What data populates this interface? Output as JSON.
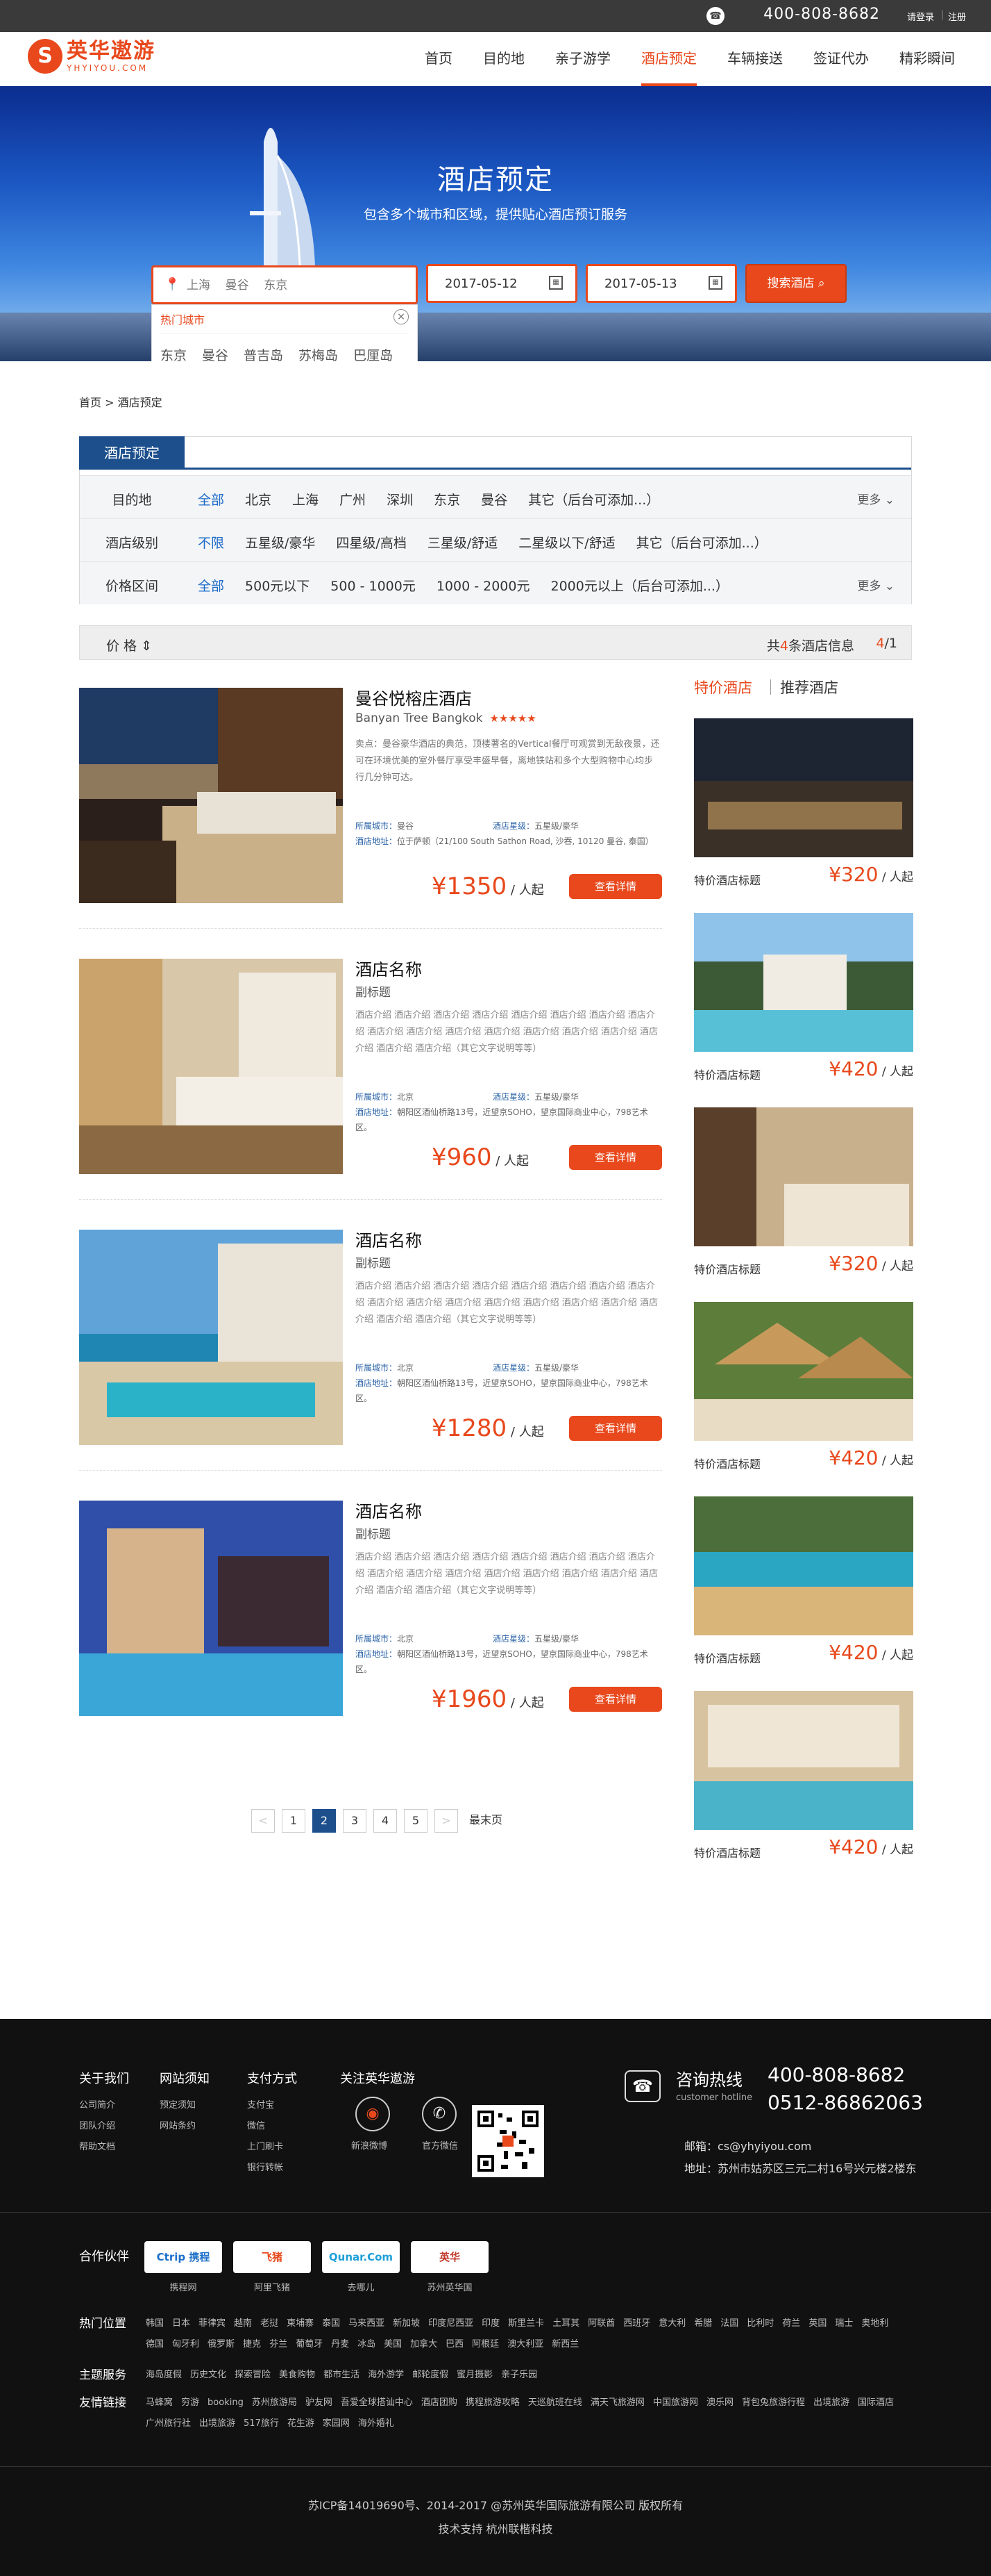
{
  "topbar": {
    "phone": "400-808-8682",
    "login": "请登录",
    "sep": "|",
    "register": "注册"
  },
  "logo": {
    "cn": "英华遨游",
    "en": "YHYIYOU.COM"
  },
  "nav": [
    "首页",
    "目的地",
    "亲子游学",
    "酒店预定",
    "车辆接送",
    "签证代办",
    "精彩瞬间"
  ],
  "banner": {
    "title": "酒店预定",
    "subtitle": "包含多个城市和区域，提供贴心酒店预订服务"
  },
  "search": {
    "placeholder": "上海    曼谷    东京",
    "checkin": "2017-05-12",
    "checkout": "2017-05-13",
    "button": "搜索酒店"
  },
  "dropdown": {
    "label": "热门城市",
    "cities": [
      "东京",
      "曼谷",
      "普吉岛",
      "苏梅岛",
      "巴厘岛"
    ]
  },
  "breadcrumb": {
    "home": "首页 >",
    "current": "酒店预定"
  },
  "filter": {
    "tab": "酒店预定",
    "rows": [
      {
        "label": "目的地",
        "options": [
          "全部",
          "北京",
          "上海",
          "广州",
          "深圳",
          "东京",
          "曼谷",
          "其它（后台可添加...）"
        ],
        "more": "更多"
      },
      {
        "label": "酒店级别",
        "options": [
          "不限",
          "五星级/豪华",
          "四星级/高档",
          "三星级/舒适",
          "二星级以下/舒适",
          "其它（后台可添加...）"
        ],
        "more": ""
      },
      {
        "label": "价格区间",
        "options": [
          "全部",
          "500元以下",
          "500 - 1000元",
          "1000 - 2000元",
          "2000元以上（后台可添加...）"
        ],
        "more": "更多"
      }
    ]
  },
  "sort": {
    "price": "价 格",
    "total_prefix": "共",
    "total": "4",
    "total_suffix": "条酒店信息",
    "page_cur": "4",
    "page_all": "/1"
  },
  "hotels": [
    {
      "name": "曼谷悦榕庄酒店",
      "sub": "Banyan Tree Bangkok",
      "stars": "★★★★★",
      "desc": "卖点：曼谷豪华酒店的典范，顶楼著名的Vertical餐厅可观赏到无敌夜景，还可在环境优美的室外餐厅享受丰盛早餐，离地铁站和多个大型购物中心均步行几分钟可达。",
      "city_k": "所属城市：",
      "city": "曼谷",
      "star_k": "酒店星级：",
      "star": "五星级/豪华",
      "addr_k": "酒店地址：",
      "addr": "位于萨顿（21/100 South Sathon Road, 沙吞, 10120 曼谷, 泰国）",
      "price": "¥1350",
      "unit": "/ 人起",
      "button": "查看详情"
    },
    {
      "name": "酒店名称",
      "sub": "副标题",
      "stars": "",
      "desc": "酒店介绍  酒店介绍  酒店介绍  酒店介绍  酒店介绍  酒店介绍  酒店介绍  酒店介绍  酒店介绍  酒店介绍  酒店介绍  酒店介绍  酒店介绍  酒店介绍  酒店介绍  酒店介绍  酒店介绍  酒店介绍（其它文字说明等等）",
      "city_k": "所属城市：",
      "city": "北京",
      "star_k": "酒店星级：",
      "star": "五星级/豪华",
      "addr_k": "酒店地址：",
      "addr": "朝阳区酒仙桥路13号，近望京SOHO，望京国际商业中心，798艺术区。",
      "price": "¥960",
      "unit": "/ 人起",
      "button": "查看详情"
    },
    {
      "name": "酒店名称",
      "sub": "副标题",
      "stars": "",
      "desc": "酒店介绍  酒店介绍  酒店介绍  酒店介绍  酒店介绍  酒店介绍  酒店介绍  酒店介绍  酒店介绍  酒店介绍  酒店介绍  酒店介绍  酒店介绍  酒店介绍  酒店介绍  酒店介绍  酒店介绍  酒店介绍（其它文字说明等等）",
      "city_k": "所属城市：",
      "city": "北京",
      "star_k": "酒店星级：",
      "star": "五星级/豪华",
      "addr_k": "酒店地址：",
      "addr": "朝阳区酒仙桥路13号，近望京SOHO，望京国际商业中心，798艺术区。",
      "price": "¥1280",
      "unit": "/ 人起",
      "button": "查看详情"
    },
    {
      "name": "酒店名称",
      "sub": "副标题",
      "stars": "",
      "desc": "酒店介绍  酒店介绍  酒店介绍  酒店介绍  酒店介绍  酒店介绍  酒店介绍  酒店介绍  酒店介绍  酒店介绍  酒店介绍  酒店介绍  酒店介绍  酒店介绍  酒店介绍  酒店介绍  酒店介绍  酒店介绍（其它文字说明等等）",
      "city_k": "所属城市：",
      "city": "北京",
      "star_k": "酒店星级：",
      "star": "五星级/豪华",
      "addr_k": "酒店地址：",
      "addr": "朝阳区酒仙桥路13号，近望京SOHO，望京国际商业中心，798艺术区。",
      "price": "¥1960",
      "unit": "/ 人起",
      "button": "查看详情"
    }
  ],
  "side": {
    "tab1": "特价酒店",
    "tab2": "推荐酒店",
    "cards": [
      {
        "title": "特价酒店标题",
        "price": "¥320",
        "unit": "/ 人起"
      },
      {
        "title": "特价酒店标题",
        "price": "¥420",
        "unit": "/ 人起"
      },
      {
        "title": "特价酒店标题",
        "price": "¥320",
        "unit": "/ 人起"
      },
      {
        "title": "特价酒店标题",
        "price": "¥420",
        "unit": "/ 人起"
      },
      {
        "title": "特价酒店标题",
        "price": "¥420",
        "unit": "/ 人起"
      },
      {
        "title": "特价酒店标题",
        "price": "¥420",
        "unit": "/ 人起"
      }
    ]
  },
  "pager": {
    "prev": "<",
    "pages": [
      "1",
      "2",
      "3",
      "4",
      "5"
    ],
    "next": ">",
    "last": "最末页"
  },
  "footer": {
    "cols": [
      {
        "h": "关于我们",
        "items": [
          "公司简介",
          "团队介绍",
          "帮助文档"
        ]
      },
      {
        "h": "网站须知",
        "items": [
          "预定须知",
          "网站条约"
        ]
      },
      {
        "h": "支付方式",
        "items": [
          "支付宝",
          "微信",
          "上门刷卡",
          "银行转帐"
        ]
      }
    ],
    "follow": {
      "h": "关注英华遨游",
      "weibo": "新浪微博",
      "wechat": "官方微信"
    },
    "hotline": {
      "label": "咨询热线",
      "label_en": "customer hotline",
      "n1": "400-808-8682",
      "n2": "0512-86862063",
      "email": "邮箱：cs@yhyiyou.com",
      "addr": "地址：苏州市姑苏区三元二村16号兴元楼2楼东"
    },
    "partners": {
      "h": "合作伙伴",
      "items": [
        {
          "logo": "Ctrip 携程",
          "name": "携程网"
        },
        {
          "logo": "飞猪",
          "name": "阿里飞猪"
        },
        {
          "logo": "Qunar.Com",
          "name": "去哪儿"
        },
        {
          "logo": "英华",
          "name": "苏州英华国"
        }
      ]
    },
    "hot": {
      "h": "热门位置",
      "items": [
        "韩国",
        "日本",
        "菲律宾",
        "越南",
        "老挝",
        "柬埔寨",
        "泰国",
        "马来西亚",
        "新加坡",
        "印度尼西亚",
        "印度",
        "斯里兰卡",
        "土耳其",
        "阿联酋",
        "西班牙",
        "意大利",
        "希腊",
        "法国",
        "比利时",
        "荷兰",
        "英国",
        "瑞士",
        "奥地利",
        "德国",
        "匈牙利",
        "俄罗斯",
        "捷克",
        "芬兰",
        "葡萄牙",
        "丹麦",
        "冰岛",
        "美国",
        "加拿大",
        "巴西",
        "阿根廷",
        "澳大利亚",
        "新西兰"
      ]
    },
    "theme": {
      "h": "主题服务",
      "items": [
        "海岛度假",
        "历史文化",
        "探索冒险",
        "美食购物",
        "都市生活",
        "海外游学",
        "邮轮度假",
        "蜜月摄影",
        "亲子乐园"
      ]
    },
    "links": {
      "h": "友情链接",
      "items": [
        "马蜂窝",
        "穷游",
        "booking",
        "苏州旅游局",
        "驴友网",
        "吾爱全球搭讪中心",
        "酒店团购",
        "携程旅游攻略",
        "天巡航班在线",
        "满天飞旅游网",
        "中国旅游网",
        "澳乐网",
        "背包兔旅游行程",
        "出境旅游",
        "国际酒店",
        "广州旅行社",
        "出境旅游",
        "517旅行",
        "花生游",
        "家园网",
        "海外婚礼"
      ]
    },
    "copyright": "苏ICP备14019690号、2014-2017  @苏州英华国际旅游有限公司 版权所有",
    "support": "技术支持  杭州联楷科技"
  }
}
